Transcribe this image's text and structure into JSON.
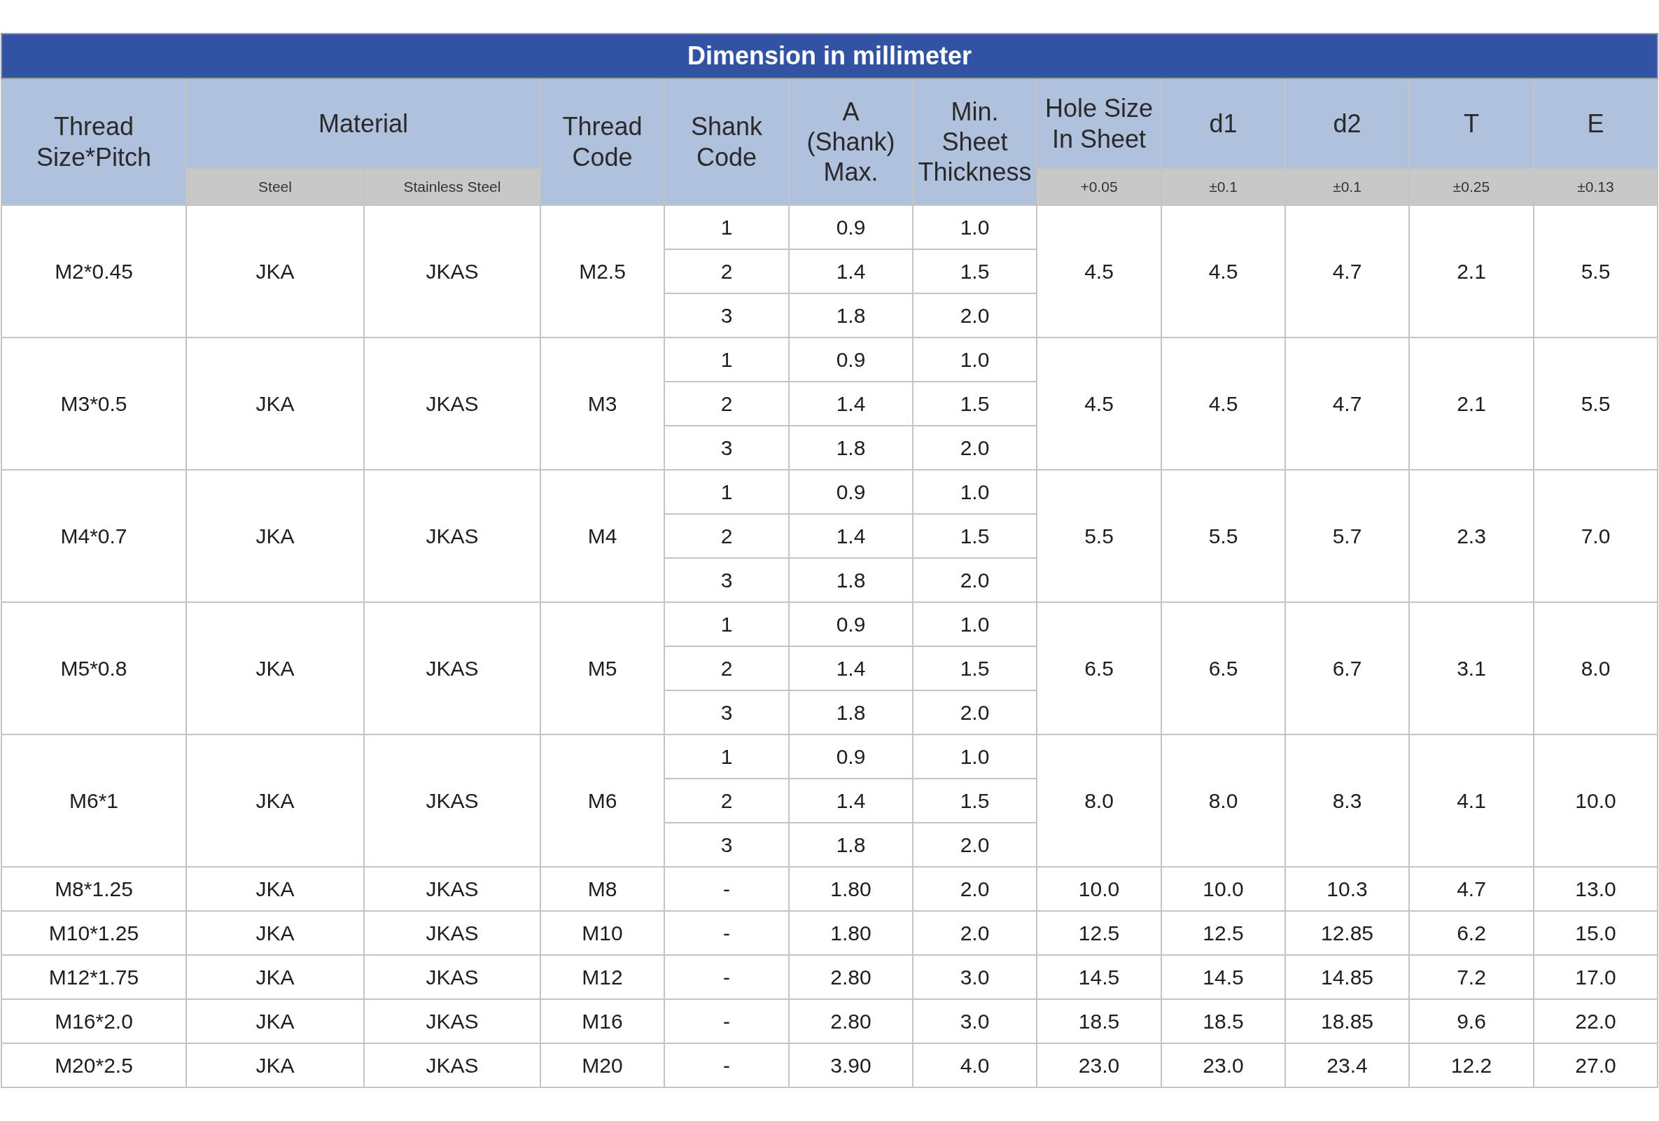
{
  "title": "Dimension in millimeter",
  "columns": [
    {
      "label": "Thread\nSize*Pitch"
    },
    {
      "label": "Material",
      "sub": [
        "Steel",
        "Stainless Steel"
      ]
    },
    {
      "label": "Thread\nCode"
    },
    {
      "label": "Shank\nCode"
    },
    {
      "label": "A\n(Shank)\nMax."
    },
    {
      "label": "Min.\nSheet\nThickness"
    },
    {
      "label": "Hole Size\nIn Sheet",
      "tolerance": "+0.05"
    },
    {
      "label": "d1",
      "tolerance": "±0.1"
    },
    {
      "label": "d2",
      "tolerance": "±0.1"
    },
    {
      "label": "T",
      "tolerance": "±0.25"
    },
    {
      "label": "E",
      "tolerance": "±0.13"
    }
  ],
  "rows": [
    {
      "thread": "M2*0.45",
      "steel": "JKA",
      "stainless": "JKAS",
      "code": "M2.5",
      "variants": [
        {
          "shank": "1",
          "a": "0.9",
          "min": "1.0"
        },
        {
          "shank": "2",
          "a": "1.4",
          "min": "1.5"
        },
        {
          "shank": "3",
          "a": "1.8",
          "min": "2.0"
        }
      ],
      "hole": "4.5",
      "d1": "4.5",
      "d2": "4.7",
      "t": "2.1",
      "e": "5.5"
    },
    {
      "thread": "M3*0.5",
      "steel": "JKA",
      "stainless": "JKAS",
      "code": "M3",
      "variants": [
        {
          "shank": "1",
          "a": "0.9",
          "min": "1.0"
        },
        {
          "shank": "2",
          "a": "1.4",
          "min": "1.5"
        },
        {
          "shank": "3",
          "a": "1.8",
          "min": "2.0"
        }
      ],
      "hole": "4.5",
      "d1": "4.5",
      "d2": "4.7",
      "t": "2.1",
      "e": "5.5"
    },
    {
      "thread": "M4*0.7",
      "steel": "JKA",
      "stainless": "JKAS",
      "code": "M4",
      "variants": [
        {
          "shank": "1",
          "a": "0.9",
          "min": "1.0"
        },
        {
          "shank": "2",
          "a": "1.4",
          "min": "1.5"
        },
        {
          "shank": "3",
          "a": "1.8",
          "min": "2.0"
        }
      ],
      "hole": "5.5",
      "d1": "5.5",
      "d2": "5.7",
      "t": "2.3",
      "e": "7.0"
    },
    {
      "thread": "M5*0.8",
      "steel": "JKA",
      "stainless": "JKAS",
      "code": "M5",
      "variants": [
        {
          "shank": "1",
          "a": "0.9",
          "min": "1.0"
        },
        {
          "shank": "2",
          "a": "1.4",
          "min": "1.5"
        },
        {
          "shank": "3",
          "a": "1.8",
          "min": "2.0"
        }
      ],
      "hole": "6.5",
      "d1": "6.5",
      "d2": "6.7",
      "t": "3.1",
      "e": "8.0"
    },
    {
      "thread": "M6*1",
      "steel": "JKA",
      "stainless": "JKAS",
      "code": "M6",
      "variants": [
        {
          "shank": "1",
          "a": "0.9",
          "min": "1.0"
        },
        {
          "shank": "2",
          "a": "1.4",
          "min": "1.5"
        },
        {
          "shank": "3",
          "a": "1.8",
          "min": "2.0"
        }
      ],
      "hole": "8.0",
      "d1": "8.0",
      "d2": "8.3",
      "t": "4.1",
      "e": "10.0"
    },
    {
      "thread": "M8*1.25",
      "steel": "JKA",
      "stainless": "JKAS",
      "code": "M8",
      "variants": [
        {
          "shank": "-",
          "a": "1.80",
          "min": "2.0"
        }
      ],
      "hole": "10.0",
      "d1": "10.0",
      "d2": "10.3",
      "t": "4.7",
      "e": "13.0"
    },
    {
      "thread": "M10*1.25",
      "steel": "JKA",
      "stainless": "JKAS",
      "code": "M10",
      "variants": [
        {
          "shank": "-",
          "a": "1.80",
          "min": "2.0"
        }
      ],
      "hole": "12.5",
      "d1": "12.5",
      "d2": "12.85",
      "t": "6.2",
      "e": "15.0"
    },
    {
      "thread": "M12*1.75",
      "steel": "JKA",
      "stainless": "JKAS",
      "code": "M12",
      "variants": [
        {
          "shank": "-",
          "a": "2.80",
          "min": "3.0"
        }
      ],
      "hole": "14.5",
      "d1": "14.5",
      "d2": "14.85",
      "t": "7.2",
      "e": "17.0"
    },
    {
      "thread": "M16*2.0",
      "steel": "JKA",
      "stainless": "JKAS",
      "code": "M16",
      "variants": [
        {
          "shank": "-",
          "a": "2.80",
          "min": "3.0"
        }
      ],
      "hole": "18.5",
      "d1": "18.5",
      "d2": "18.85",
      "t": "9.6",
      "e": "22.0"
    },
    {
      "thread": "M20*2.5",
      "steel": "JKA",
      "stainless": "JKAS",
      "code": "M20",
      "variants": [
        {
          "shank": "-",
          "a": "3.90",
          "min": "4.0"
        }
      ],
      "hole": "23.0",
      "d1": "23.0",
      "d2": "23.4",
      "t": "12.2",
      "e": "27.0"
    }
  ]
}
